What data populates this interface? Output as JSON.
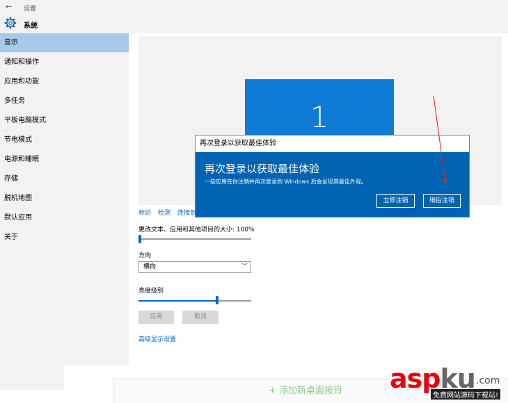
{
  "window": {
    "back_glyph": "←",
    "title": "设置"
  },
  "header": {
    "title": "系统",
    "icon": "gear-icon"
  },
  "sidebar": {
    "items": [
      {
        "label": "显示",
        "active": true
      },
      {
        "label": "通知和操作"
      },
      {
        "label": "应用和功能"
      },
      {
        "label": "多任务"
      },
      {
        "label": "平板电脑模式"
      },
      {
        "label": "节电模式"
      },
      {
        "label": "电源和睡眠"
      },
      {
        "label": "存储"
      },
      {
        "label": "脱机地图"
      },
      {
        "label": "默认应用"
      },
      {
        "label": "关于"
      }
    ]
  },
  "display": {
    "monitor_number": "1",
    "links": [
      "标识",
      "检测",
      "连接到"
    ],
    "scale_label": "更改文本、应用和其他项目的大小: 100%",
    "scale_value": 0,
    "orientation_label": "方向",
    "orientation_value": "横向",
    "brightness_label": "亮度级别",
    "brightness_value": 0.7,
    "apply_label": "应用",
    "cancel_label": "取消",
    "advanced_link": "高级显示设置"
  },
  "dialog": {
    "title": "再次登录以获取最佳体验",
    "heading": "再次登录以获取最佳体验",
    "message": "一些应用在你注销并再次登录到 Windows 后会呈现其最佳外观。",
    "signout_now": "立即注销",
    "signout_later": "稍后注销"
  },
  "bottom": {
    "text": "+ 添加新桌面按目"
  },
  "watermark": {
    "asp": "asp",
    "ku": "ku",
    "domain": ".com",
    "tagline": "免费网站源码下载站!"
  },
  "colors": {
    "accent": "#0063b1",
    "selection": "#a7c9ea",
    "arrow": "#e02020"
  }
}
